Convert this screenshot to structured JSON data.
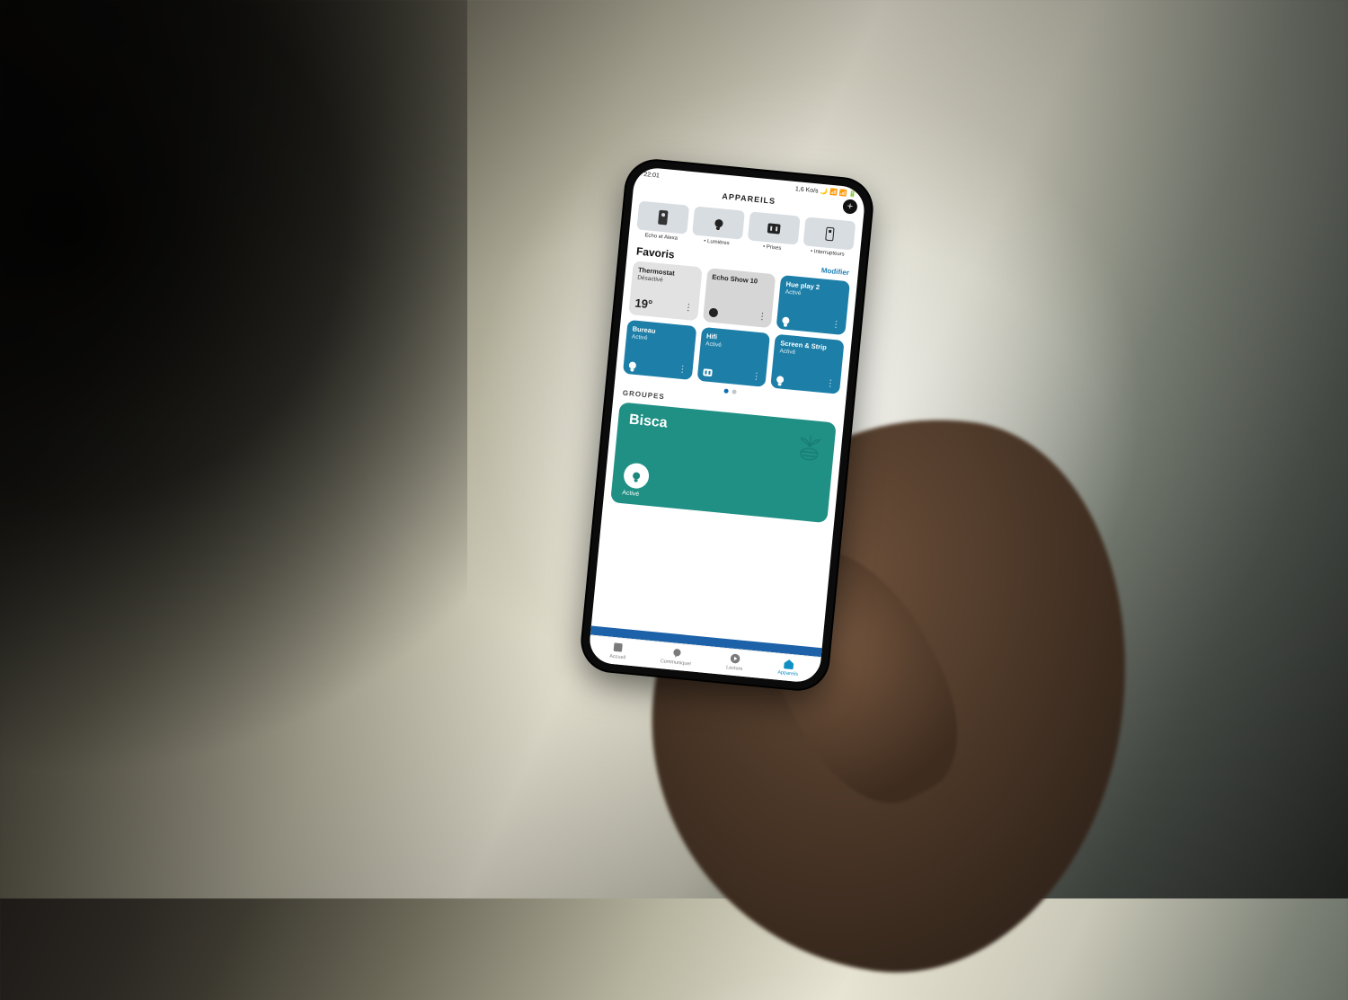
{
  "status": {
    "time": "22:01",
    "net": "1,6 Ko/s"
  },
  "header": {
    "title": "APPAREILS"
  },
  "categories": [
    {
      "label": "Echo et Alexa",
      "icon": "speaker-icon"
    },
    {
      "label": "• Lumières",
      "icon": "bulb-icon"
    },
    {
      "label": "• Prises",
      "icon": "plug-icon"
    },
    {
      "label": "• Interrupteurs",
      "icon": "switch-icon"
    }
  ],
  "favorites": {
    "heading": "Favoris",
    "action": "Modifier",
    "tiles": [
      {
        "name": "Thermostat",
        "state": "Désactivé",
        "value": "19°",
        "variant": "off",
        "icon": null
      },
      {
        "name": "Echo Show 10",
        "state": "",
        "value": "",
        "variant": "grey",
        "icon": "speaker-dot"
      },
      {
        "name": "Hue play 2",
        "state": "Activé",
        "value": "",
        "variant": "on",
        "icon": "bulb"
      },
      {
        "name": "Bureau",
        "state": "Activé",
        "value": "",
        "variant": "on",
        "icon": "bulb"
      },
      {
        "name": "Hifi",
        "state": "Activé",
        "value": "",
        "variant": "on",
        "icon": "plug"
      },
      {
        "name": "Screen & Strip",
        "state": "Activé",
        "value": "",
        "variant": "on",
        "icon": "bulb"
      }
    ],
    "pager": {
      "total": 2,
      "active": 0
    }
  },
  "groups": {
    "heading": "GROUPES",
    "card": {
      "name": "Bisca",
      "state": "Activé"
    }
  },
  "tabs": [
    {
      "label": "Accueil",
      "icon": "home-icon",
      "active": false
    },
    {
      "label": "Communiquer",
      "icon": "chat-icon",
      "active": false
    },
    {
      "label": "Lecture",
      "icon": "play-icon",
      "active": false
    },
    {
      "label": "Appareils",
      "icon": "devices-icon",
      "active": true
    }
  ],
  "colors": {
    "accent": "#1d7fa8",
    "group": "#209084",
    "link": "#1d7fb5"
  }
}
